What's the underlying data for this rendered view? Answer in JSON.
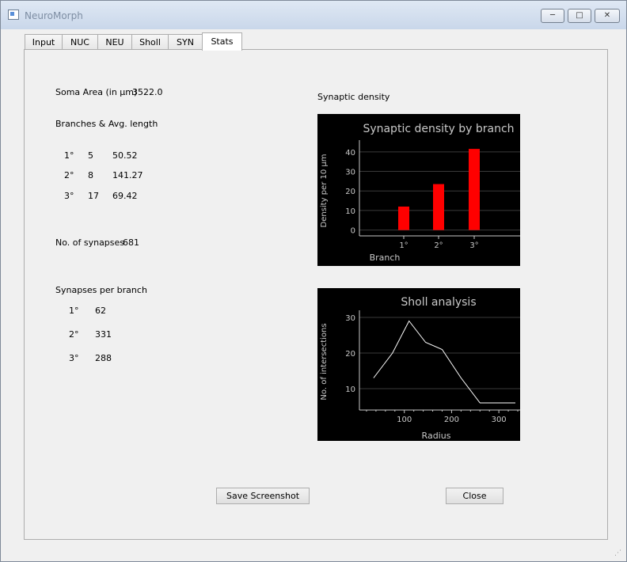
{
  "window": {
    "title": "NeuroMorph",
    "minimize": "─",
    "maximize": "□",
    "close": "✕"
  },
  "tabs": [
    "Input",
    "NUC",
    "NEU",
    "Sholl",
    "SYN",
    "Stats"
  ],
  "stats": {
    "soma_label": "Soma Area (in µm)",
    "soma_value": "3522.0",
    "branches_label": "Branches & Avg. length",
    "branches": [
      {
        "order": "1°",
        "count": "5",
        "length": "50.52"
      },
      {
        "order": "2°",
        "count": "8",
        "length": "141.27"
      },
      {
        "order": "3°",
        "count": "17",
        "length": "69.42"
      }
    ],
    "synapses_label": "No. of synapses",
    "synapses_value": "681",
    "per_branch_label": "Synapses per branch",
    "per_branch": [
      {
        "order": "1°",
        "value": "62"
      },
      {
        "order": "2°",
        "value": "331"
      },
      {
        "order": "3°",
        "value": "288"
      }
    ],
    "synaptic_density_label": "Synaptic density"
  },
  "buttons": {
    "save": "Save Screenshot",
    "close": "Close"
  },
  "colors": {
    "bar": "#ff0000",
    "line": "#ffffff",
    "chart_bg": "#000000",
    "axis_text": "#c8c8c8"
  },
  "chart_data": [
    {
      "type": "bar",
      "title": "Synaptic density by branch",
      "xlabel": "Branch",
      "ylabel": "Density per 10 µm",
      "categories": [
        "1°",
        "2°",
        "3°"
      ],
      "values": [
        12,
        23.5,
        41.5
      ],
      "yticks": [
        0,
        10,
        20,
        30,
        40
      ],
      "ylim": [
        -3,
        46
      ]
    },
    {
      "type": "line",
      "title": "Sholl analysis",
      "xlabel": "Radius",
      "ylabel": "No. of intersections",
      "x": [
        35,
        75,
        110,
        145,
        180,
        220,
        260,
        300,
        335
      ],
      "y": [
        13,
        20,
        29,
        23,
        21,
        13,
        6,
        6,
        6
      ],
      "xticks": [
        100,
        200,
        300
      ],
      "yticks": [
        10,
        20,
        30
      ],
      "xlim": [
        5,
        345
      ],
      "ylim": [
        4,
        32
      ]
    }
  ]
}
